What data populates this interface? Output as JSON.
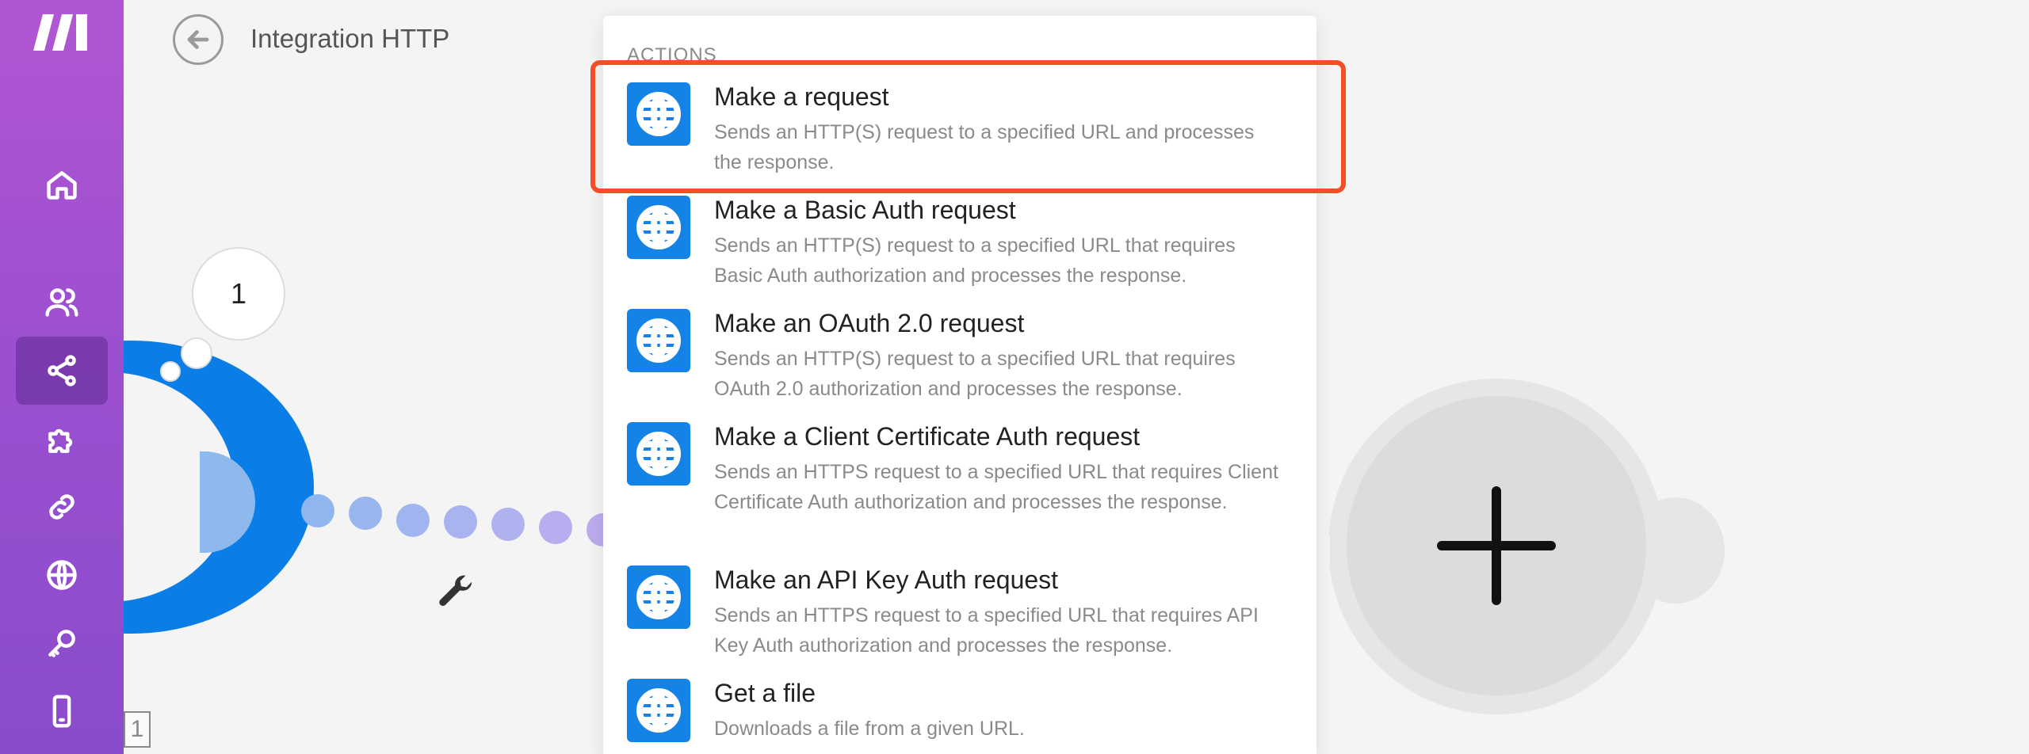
{
  "sidebar": {
    "items": [
      {
        "name": "home",
        "icon": "home-icon"
      },
      {
        "name": "team",
        "icon": "users-icon"
      },
      {
        "name": "scenarios",
        "icon": "share-icon",
        "active": true
      },
      {
        "name": "templates",
        "icon": "puzzle-icon"
      },
      {
        "name": "connections",
        "icon": "link-icon"
      },
      {
        "name": "webhooks",
        "icon": "globe-icon"
      },
      {
        "name": "keys",
        "icon": "key-icon"
      },
      {
        "name": "devices",
        "icon": "mobile-icon"
      }
    ]
  },
  "header": {
    "title": "Integration HTTP"
  },
  "canvas": {
    "bubble_number": "1",
    "module_count": "1"
  },
  "panel": {
    "section_label": "ACTIONS",
    "actions": [
      {
        "title": "Make a request",
        "desc": "Sends an HTTP(S) request to a specified URL and processes the response."
      },
      {
        "title": "Make a Basic Auth request",
        "desc": "Sends an HTTP(S) request to a specified URL that requires Basic Auth authorization and processes the response."
      },
      {
        "title": "Make an OAuth 2.0 request",
        "desc": "Sends an HTTP(S) request to a specified URL that requires OAuth 2.0 authorization and processes the response."
      },
      {
        "title": "Make a Client Certificate Auth request",
        "desc": "Sends an HTTPS request to a specified URL that requires Client Certificate Auth authorization and processes the response."
      },
      {
        "title": "Make an API Key Auth request",
        "desc": "Sends an HTTPS request to a specified URL that requires API Key Auth authorization and processes the response."
      },
      {
        "title": "Get a file",
        "desc": "Downloads a file from a given URL."
      }
    ]
  },
  "colors": {
    "accent": "#1583e6",
    "highlight": "#f24e28",
    "sidebar_top": "#b156d2",
    "sidebar_bottom": "#8a4ccc"
  }
}
